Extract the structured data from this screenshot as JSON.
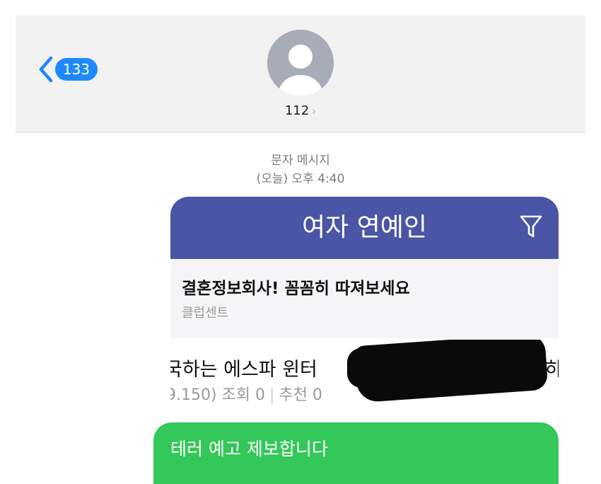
{
  "header": {
    "back_count": "133",
    "contact_name": "112",
    "contact_chevron": "›"
  },
  "thread": {
    "message_type": "문자 메시지",
    "timestamp": "(오늘) 오후 4:40"
  },
  "screenshot_message": {
    "bar_title": "여자 연예인",
    "ad_title": "결혼정보회사! 꼼꼼히 따져보세요",
    "ad_source": "클럽센트",
    "post_title": "국하는 에스파 윈터",
    "post_title_tail": "하",
    "post_stats_prefix": "9.150) 조회 0",
    "post_stats_sep": "|",
    "post_stats_suffix": "추천 0"
  },
  "sent_message": {
    "text": "테러 예고 제보합니다"
  },
  "colors": {
    "accent": "#1e88ff",
    "bar": "#4a55a5",
    "sent_bubble": "#34c759"
  },
  "icons": [
    "back-chevron-icon",
    "person-avatar-icon",
    "filter-icon"
  ]
}
